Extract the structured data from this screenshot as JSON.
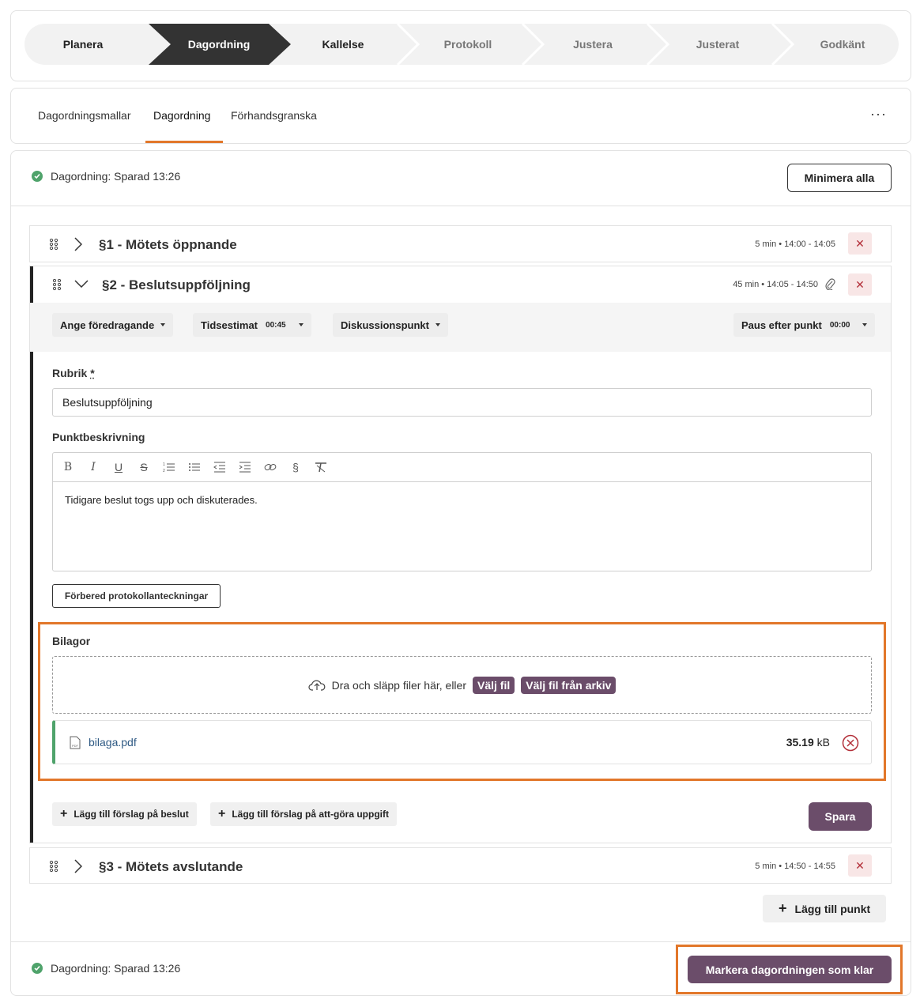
{
  "stepper": {
    "steps": [
      {
        "label": "Planera",
        "state": "done"
      },
      {
        "label": "Dagordning",
        "state": "active"
      },
      {
        "label": "Kallelse",
        "state": "done"
      },
      {
        "label": "Protokoll",
        "state": "todo"
      },
      {
        "label": "Justera",
        "state": "todo"
      },
      {
        "label": "Justerat",
        "state": "todo"
      },
      {
        "label": "Godkänt",
        "state": "todo"
      }
    ]
  },
  "tabs": {
    "items": [
      "Dagordningsmallar",
      "Dagordning",
      "Förhandsgranska"
    ],
    "active": "Dagordning",
    "more": "···"
  },
  "header": {
    "status": "Dagordning: Sparad 13:26",
    "minimize_all": "Minimera alla"
  },
  "items": [
    {
      "title": "§1 - Mötets öppnande",
      "time": "5 min • 14:00 - 14:05",
      "expanded": false
    },
    {
      "title": "§2 - Beslutsuppföljning",
      "time": "45 min • 14:05 - 14:50",
      "expanded": true,
      "has_attachment": true
    },
    {
      "title": "§3 - Mötets avslutande",
      "time": "5 min • 14:50 - 14:55",
      "expanded": false
    }
  ],
  "expanded_item": {
    "presenter": "Ange föredragande",
    "time_estimate_label": "Tidsestimat",
    "time_estimate_value": "00:45",
    "item_type": "Diskussionspunkt",
    "pause_label": "Paus efter punkt",
    "pause_value": "00:00",
    "heading_label": "Rubrik",
    "required_mark": "*",
    "heading_value": "Beslutsuppföljning",
    "description_label": "Punktbeskrivning",
    "description_text": "Tidigare beslut togs upp och diskuterades.",
    "editor_tools": [
      "bold-icon",
      "italic-icon",
      "underline-icon",
      "strikethrough-icon",
      "ordered-list-icon",
      "bullet-list-icon",
      "outdent-icon",
      "indent-icon",
      "link-icon",
      "paragraph-sign-icon",
      "clear-format-icon"
    ],
    "prepare_notes": "Förbered protokollanteckningar",
    "attachments_label": "Bilagor",
    "dropzone_text": "Dra och släpp filer här, eller",
    "choose_file": "Välj fil",
    "choose_from_archive": "Välj fil från arkiv",
    "file_name": "bilaga.pdf",
    "file_size_value": "35.19",
    "file_size_unit": "kB",
    "add_decision": "Lägg till förslag på beslut",
    "add_task": "Lägg till förslag på att-göra uppgift",
    "save": "Spara"
  },
  "add_item": "Lägg till punkt",
  "footer": {
    "status": "Dagordning: Sparad 13:26",
    "mark_done": "Markera dagordningen som klar"
  },
  "colors": {
    "accent_orange": "#e2772a",
    "brand_purple": "#6b4d6a",
    "success_green": "#4fa36b",
    "danger_red": "#b3303a"
  }
}
